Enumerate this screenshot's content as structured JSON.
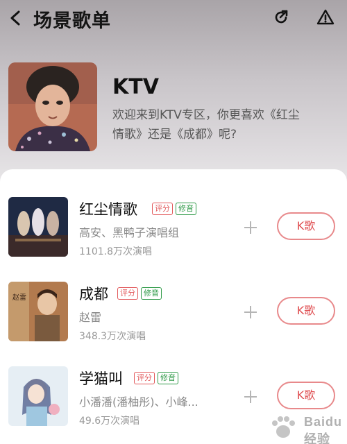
{
  "header": {
    "title": "场景歌单",
    "back_icon": "chevron-left-icon",
    "share_icon": "share-icon",
    "report_icon": "warning-icon"
  },
  "playlist": {
    "name": "KTV",
    "description_line1": "欢迎来到KTV专区，你更喜欢《红尘",
    "description_line2": "情歌》还是《成都》呢?"
  },
  "songs": [
    {
      "title": "红尘情歌",
      "tag_score": "评分",
      "tag_fix": "修音",
      "artist": "高安、黑鸭子演唱组",
      "count": "1101.8万次演唱",
      "button": "K歌"
    },
    {
      "title": "成都",
      "tag_score": "评分",
      "tag_fix": "修音",
      "artist": "赵雷",
      "count": "348.3万次演唱",
      "button": "K歌"
    },
    {
      "title": "学猫叫",
      "tag_score": "评分",
      "tag_fix": "修音",
      "artist": "小潘潘(潘柚彤)、小峰...",
      "count": "49.6万次演唱",
      "button": "K歌"
    }
  ],
  "watermark": {
    "text": "Baidu 经验"
  },
  "colors": {
    "accent": "#df4d50",
    "tag_green": "#2e9a47"
  }
}
